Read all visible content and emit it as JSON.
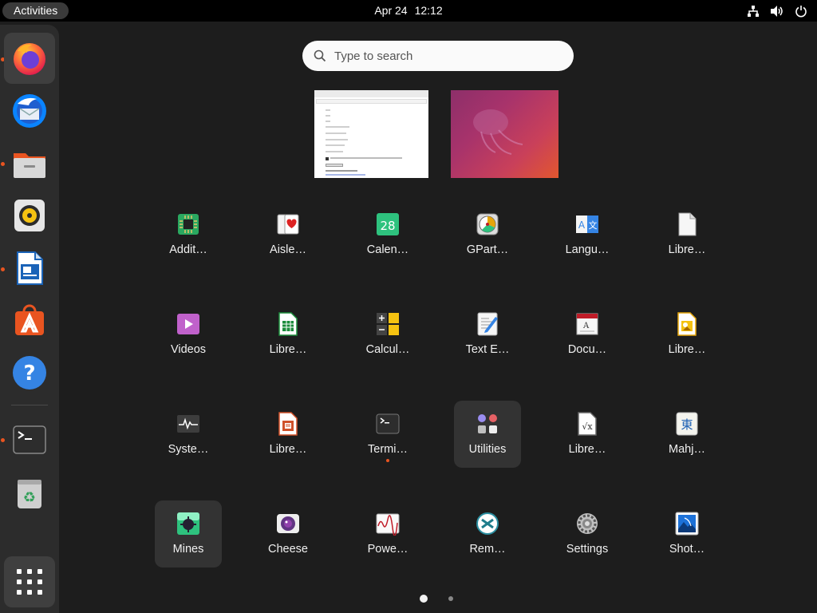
{
  "topbar": {
    "activities_label": "Activities",
    "date": "Apr 24",
    "time": "12:12",
    "tray_icons": [
      "network-icon",
      "volume-icon",
      "power-icon"
    ]
  },
  "dock": {
    "items": [
      {
        "name": "firefox",
        "running": true,
        "active": true
      },
      {
        "name": "thunderbird",
        "running": false
      },
      {
        "name": "files",
        "running": true
      },
      {
        "name": "rhythmbox",
        "running": false
      },
      {
        "name": "libreoffice-writer",
        "running": true
      },
      {
        "name": "ubuntu-software",
        "running": false
      },
      {
        "name": "help",
        "running": false
      },
      {
        "name": "terminal",
        "running": true
      },
      {
        "name": "trash",
        "running": false
      },
      {
        "name": "show-applications",
        "running": false
      }
    ]
  },
  "search": {
    "placeholder": "Type to search"
  },
  "apps": [
    {
      "label": "Addit…",
      "icon": "additional-drivers-icon"
    },
    {
      "label": "Aisle…",
      "icon": "aisleriot-cards-icon"
    },
    {
      "label": "Calen…",
      "icon": "calendar-icon",
      "icon_text": "28"
    },
    {
      "label": "GPart…",
      "icon": "gparted-icon"
    },
    {
      "label": "Langu…",
      "icon": "language-support-icon",
      "icon_text": "A 文"
    },
    {
      "label": "Libre…",
      "icon": "libreoffice-icon"
    },
    {
      "label": "Videos",
      "icon": "videos-icon"
    },
    {
      "label": "Libre…",
      "icon": "libreoffice-calc-icon"
    },
    {
      "label": "Calcul…",
      "icon": "calculator-icon"
    },
    {
      "label": "Text E…",
      "icon": "text-editor-icon"
    },
    {
      "label": "Docu…",
      "icon": "document-viewer-icon"
    },
    {
      "label": "Libre…",
      "icon": "libreoffice-draw-icon"
    },
    {
      "label": "Syste…",
      "icon": "system-monitor-icon"
    },
    {
      "label": "Libre…",
      "icon": "libreoffice-impress-icon"
    },
    {
      "label": "Termi…",
      "icon": "terminal-icon",
      "running": true
    },
    {
      "label": "Utilities",
      "icon": "utilities-folder-icon",
      "highlighted": true
    },
    {
      "label": "Libre…",
      "icon": "libreoffice-math-icon"
    },
    {
      "label": "Mahj…",
      "icon": "mahjongg-icon",
      "icon_text": "東"
    },
    {
      "label": "Mines",
      "icon": "mines-icon",
      "highlighted": true
    },
    {
      "label": "Cheese",
      "icon": "cheese-icon"
    },
    {
      "label": "Powe…",
      "icon": "power-statistics-icon"
    },
    {
      "label": "Rem…",
      "icon": "remmina-icon"
    },
    {
      "label": "Settings",
      "icon": "settings-gear-icon"
    },
    {
      "label": "Shot…",
      "icon": "shotwell-icon"
    }
  ],
  "pager": {
    "pages": 2,
    "current": 1
  }
}
